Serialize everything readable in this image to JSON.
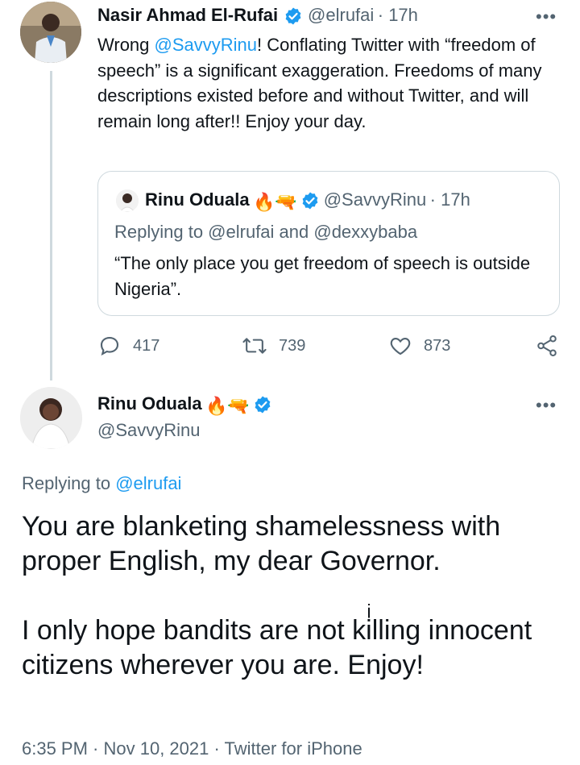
{
  "tweet1": {
    "author_name": "Nasir Ahmad El-Rufai",
    "handle": "@elrufai",
    "time": "· 17h",
    "more": "•••",
    "text_prefix": "Wrong ",
    "mention": "@SavvyRinu",
    "text_suffix": "! Conflating Twitter with “freedom of speech” is a significant exaggeration. Freedoms of many descriptions existed before and without Twitter, and will remain long after!! Enjoy your day.",
    "quoted": {
      "author_name": "Rinu Oduala",
      "emojis": "🔥🔫",
      "handle": "@SavvyRinu",
      "time": "· 17h",
      "replying": "Replying to @elrufai and @dexxybaba",
      "text": "“The only place you get freedom of speech is outside Nigeria”."
    },
    "actions": {
      "replies": "417",
      "retweets": "739",
      "likes": "873",
      "icons": [
        "comment-icon",
        "retweet-icon",
        "heart-icon",
        "share-icon"
      ]
    }
  },
  "tweet2": {
    "author_name": "Rinu Oduala",
    "emojis": "🔥🔫",
    "handle": "@SavvyRinu",
    "more": "•••",
    "replying_prefix": "Replying to ",
    "replying_mention": "@elrufai",
    "text_line1": "You are blanketing shamelessness with proper English, my dear Governor.",
    "text_line2": "I only hope bandits are not kiͥlling innocent citizens wherever you are. Enjoy!",
    "timestamp": "6:35 PM · Nov 10, 2021 · Twitter for iPhone"
  },
  "colors": {
    "accent": "#1d9bf0",
    "secondary_text": "#536471",
    "border": "#cfd9de",
    "thread_line": "#cfd9de"
  }
}
